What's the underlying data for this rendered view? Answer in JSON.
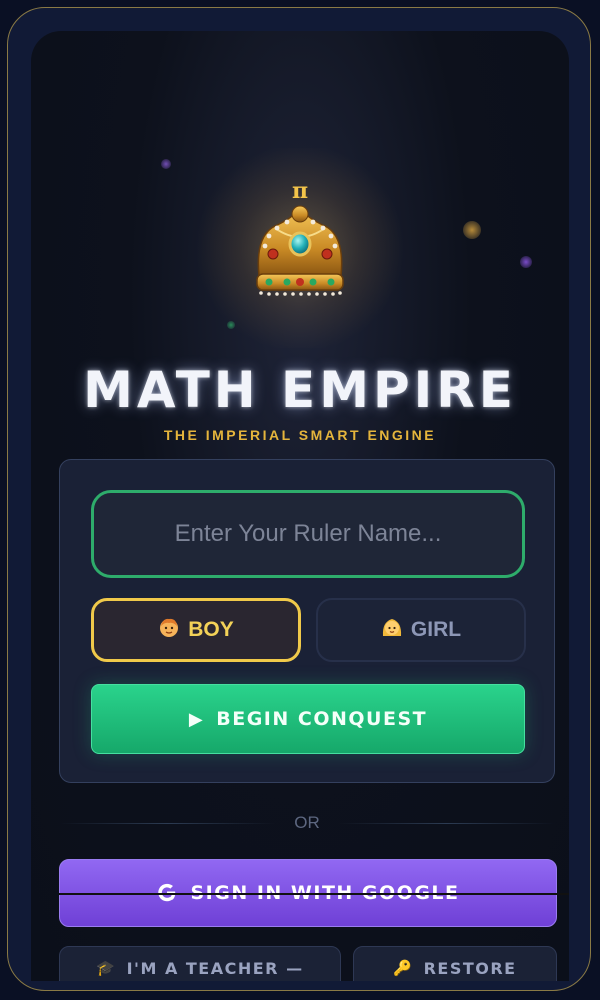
{
  "app": {
    "title": "MATH EMPIRE",
    "subtitle": "THE IMPERIAL SMART ENGINE",
    "crown_symbol": "π"
  },
  "login": {
    "name_placeholder": "Enter Your Ruler Name...",
    "gender": {
      "boy_label": "BOY",
      "girl_label": "GIRL",
      "selected": "BOY"
    },
    "begin_label": "BEGIN CONQUEST"
  },
  "divider": {
    "or_label": "OR"
  },
  "google": {
    "label": "SIGN IN WITH GOOGLE"
  },
  "footer": {
    "teacher_label": "I'M A TEACHER —",
    "restore_label": "RESTORE"
  },
  "colors": {
    "accent_green": "#2ad38c",
    "accent_gold": "#e5b53c",
    "accent_purple": "#8a5cf0"
  }
}
